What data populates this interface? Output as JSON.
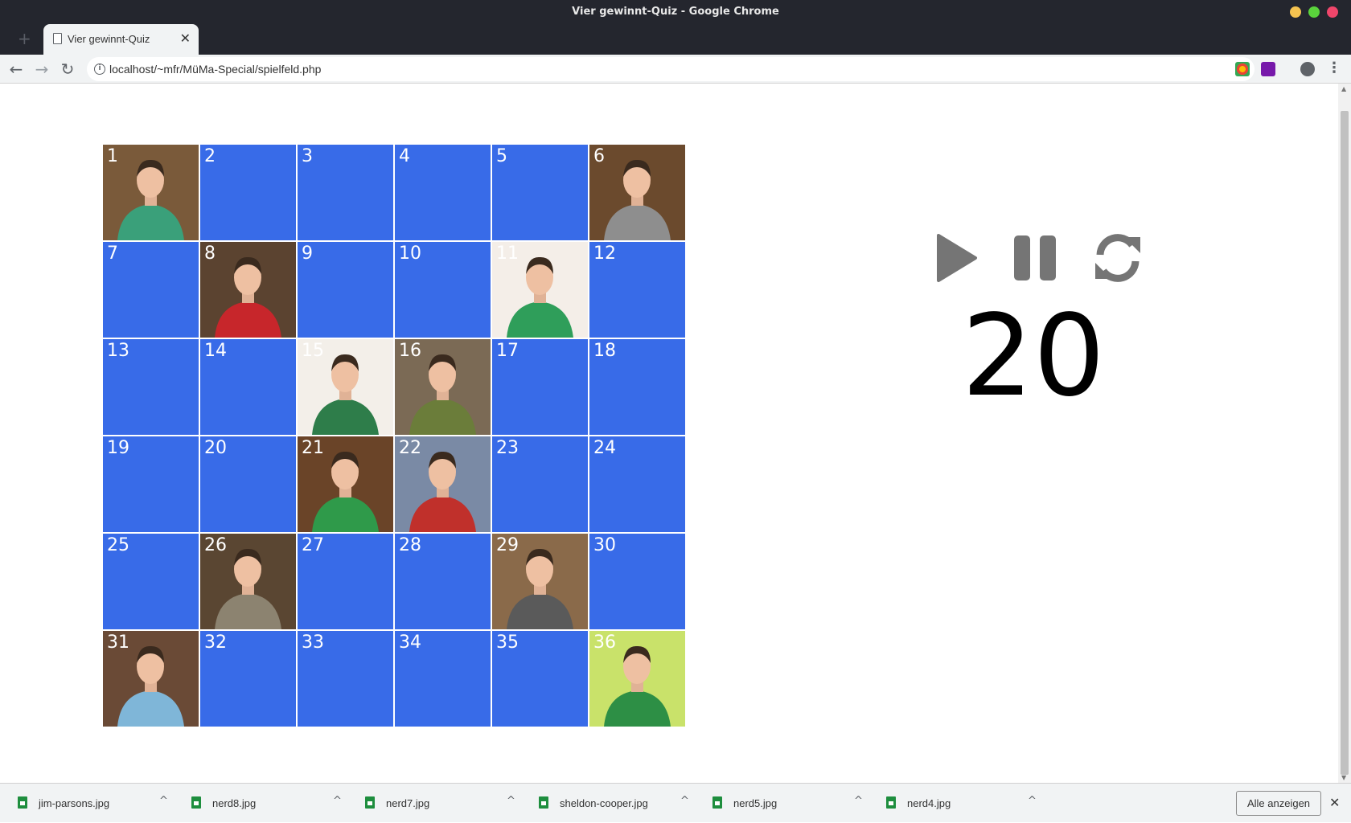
{
  "window": {
    "title": "Vier gewinnt-Quiz - Google Chrome",
    "controls": [
      {
        "name": "minimize",
        "color": "#f5c350"
      },
      {
        "name": "maximize",
        "color": "#5ad33c"
      },
      {
        "name": "close",
        "color": "#f0466b"
      }
    ]
  },
  "tab": {
    "label": "Vier gewinnt-Quiz",
    "close_glyph": "✕",
    "new_tab_glyph": "+"
  },
  "toolbar": {
    "back_glyph": "←",
    "forward_glyph": "→",
    "reload_glyph": "↻",
    "url": "localhost/~mfr/MüMa-Special/spielfeld.php",
    "info_glyph": "i",
    "bookmark_glyph": "☆",
    "menu_glyph": "⋮"
  },
  "board": {
    "hidden_color": "#386be8",
    "cells": [
      {
        "n": "1",
        "revealed": true,
        "shirt": "#3aa07a",
        "bg": "#7a5a3a"
      },
      {
        "n": "2",
        "revealed": false
      },
      {
        "n": "3",
        "revealed": false
      },
      {
        "n": "4",
        "revealed": false
      },
      {
        "n": "5",
        "revealed": false
      },
      {
        "n": "6",
        "revealed": true,
        "shirt": "#8e8e8e",
        "bg": "#6b4a2d"
      },
      {
        "n": "7",
        "revealed": false
      },
      {
        "n": "8",
        "revealed": true,
        "shirt": "#c7262b",
        "bg": "#5b4330"
      },
      {
        "n": "9",
        "revealed": false
      },
      {
        "n": "10",
        "revealed": false
      },
      {
        "n": "11",
        "revealed": true,
        "shirt": "#2f9e5a",
        "bg": "#f4eee8"
      },
      {
        "n": "12",
        "revealed": false
      },
      {
        "n": "13",
        "revealed": false
      },
      {
        "n": "14",
        "revealed": false
      },
      {
        "n": "15",
        "revealed": true,
        "shirt": "#2e7d4a",
        "bg": "#f3efe9"
      },
      {
        "n": "16",
        "revealed": true,
        "shirt": "#6b7d3a",
        "bg": "#7b6a55"
      },
      {
        "n": "17",
        "revealed": false
      },
      {
        "n": "18",
        "revealed": false
      },
      {
        "n": "19",
        "revealed": false
      },
      {
        "n": "20",
        "revealed": false
      },
      {
        "n": "21",
        "revealed": true,
        "shirt": "#2f9a4a",
        "bg": "#6a4428"
      },
      {
        "n": "22",
        "revealed": true,
        "shirt": "#c0302b",
        "bg": "#7a8aa5"
      },
      {
        "n": "23",
        "revealed": false
      },
      {
        "n": "24",
        "revealed": false
      },
      {
        "n": "25",
        "revealed": false
      },
      {
        "n": "26",
        "revealed": true,
        "shirt": "#8c8370",
        "bg": "#5a4632"
      },
      {
        "n": "27",
        "revealed": false
      },
      {
        "n": "28",
        "revealed": false
      },
      {
        "n": "29",
        "revealed": true,
        "shirt": "#5a5a5a",
        "bg": "#8a6a4a"
      },
      {
        "n": "30",
        "revealed": false
      },
      {
        "n": "31",
        "revealed": true,
        "shirt": "#7fb6d8",
        "bg": "#6a4a36"
      },
      {
        "n": "32",
        "revealed": false
      },
      {
        "n": "33",
        "revealed": false
      },
      {
        "n": "34",
        "revealed": false
      },
      {
        "n": "35",
        "revealed": false
      },
      {
        "n": "36",
        "revealed": true,
        "shirt": "#2d8f45",
        "bg": "#c9e26a"
      }
    ]
  },
  "controls": {
    "play_icon": "play-icon",
    "pause_icon": "pause-icon",
    "reset_icon": "refresh-icon",
    "icon_color": "#757575"
  },
  "timer": {
    "value": "20"
  },
  "downloads": {
    "items": [
      {
        "name": "jim-parsons.jpg"
      },
      {
        "name": "nerd8.jpg"
      },
      {
        "name": "nerd7.jpg"
      },
      {
        "name": "sheldon-cooper.jpg"
      },
      {
        "name": "nerd5.jpg"
      },
      {
        "name": "nerd4.jpg"
      }
    ],
    "caret_glyph": "^",
    "show_all_label": "Alle anzeigen",
    "close_glyph": "✕"
  }
}
